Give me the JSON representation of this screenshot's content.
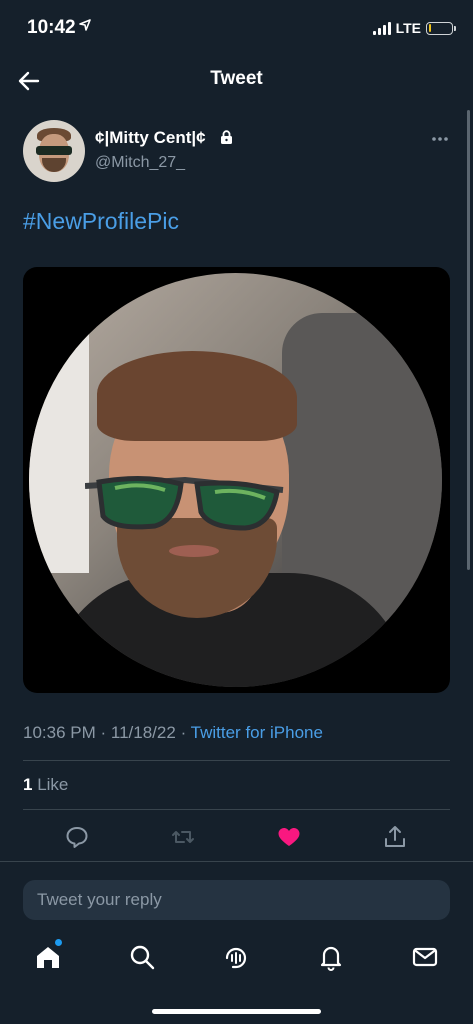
{
  "status_bar": {
    "time": "10:42",
    "network": "LTE",
    "battery_color": "#f0c419",
    "battery_level": 0.12
  },
  "nav": {
    "title": "Tweet",
    "back_icon": "arrow-left-icon"
  },
  "tweet": {
    "author": {
      "display_name": "¢|Mitty Cent|¢",
      "handle": "@Mitch_27_",
      "protected_icon": "lock-icon"
    },
    "text": "#NewProfilePic",
    "meta": {
      "time": "10:36 PM",
      "separator": "·",
      "date": "11/18/22",
      "source": "Twitter for iPhone"
    },
    "likes": {
      "count": "1",
      "label": "Like"
    },
    "actions": {
      "reply_icon": "reply-icon",
      "retweet_icon": "retweet-icon",
      "like_icon": "heart-icon",
      "like_color": "#f91880",
      "share_icon": "share-icon"
    }
  },
  "reply": {
    "placeholder": "Tweet your reply"
  },
  "tab_bar": {
    "items": [
      "home-icon",
      "search-icon",
      "spaces-icon",
      "notifications-icon",
      "messages-icon"
    ]
  },
  "colors": {
    "background": "#15202b",
    "accent": "#4a9ee6",
    "muted": "#8b98a5"
  }
}
